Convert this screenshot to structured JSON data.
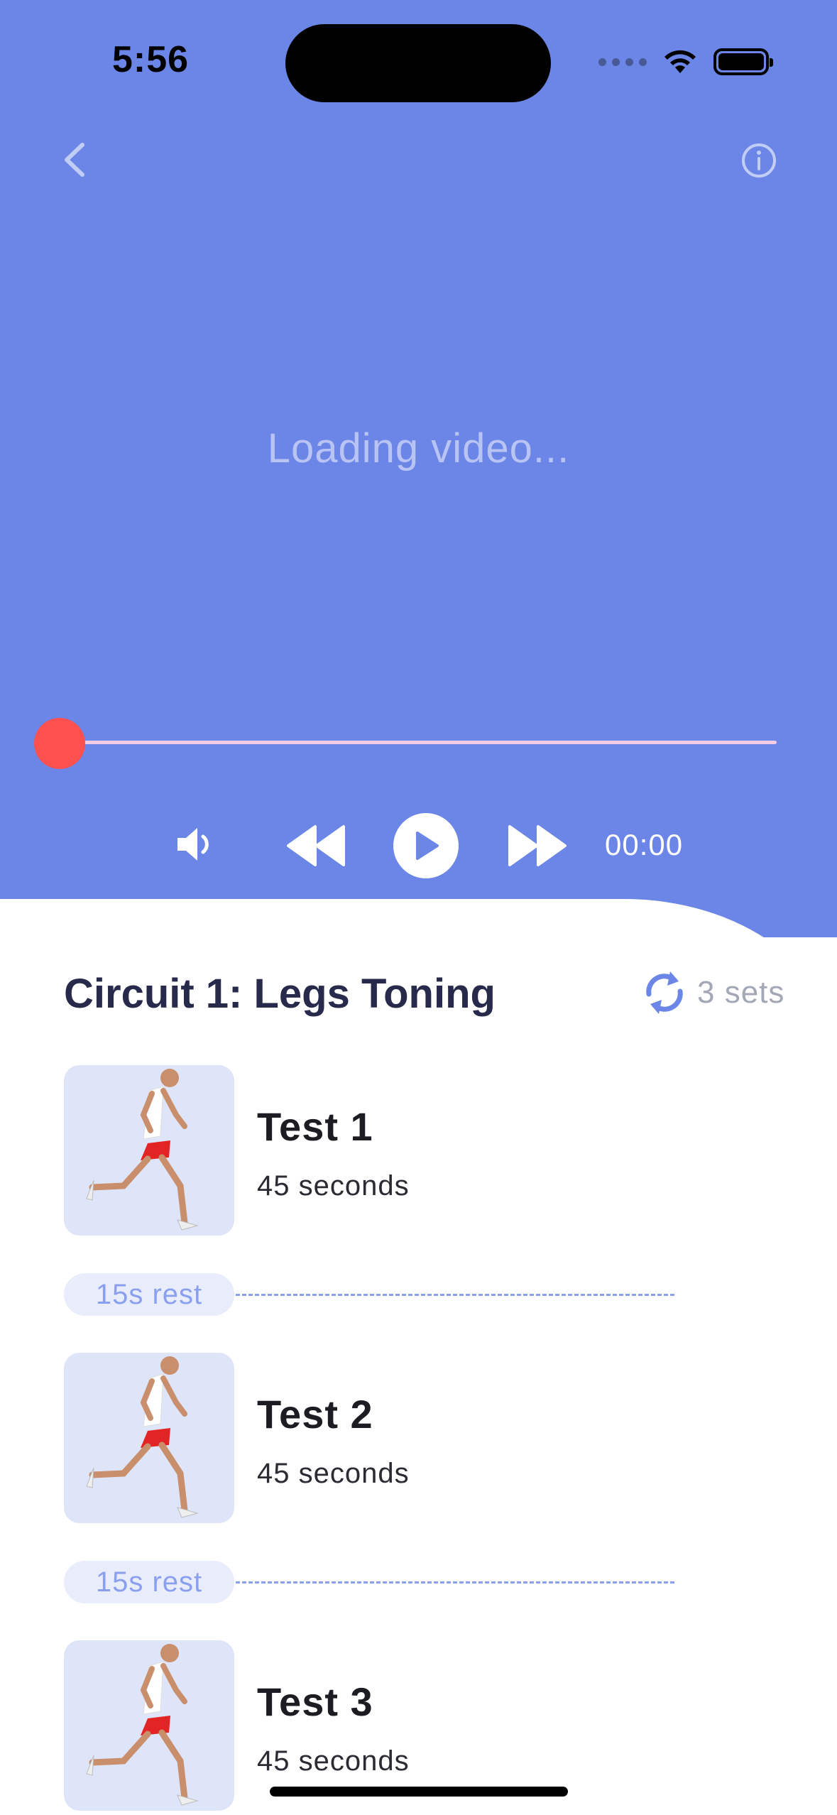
{
  "status_bar": {
    "time": "5:56"
  },
  "player": {
    "loading_text": "Loading video...",
    "progress": 0,
    "time": "00:00"
  },
  "circuit": {
    "title": "Circuit 1: Legs Toning",
    "sets": "3 sets"
  },
  "exercises": [
    {
      "name": "Test 1",
      "duration": "45 seconds"
    },
    {
      "name": "Test 2",
      "duration": "45 seconds"
    },
    {
      "name": "Test 3",
      "duration": "45 seconds"
    }
  ],
  "rests": [
    {
      "label": "15s rest"
    },
    {
      "label": "15s rest"
    }
  ],
  "icons": {
    "back": "chevron-left-icon",
    "info": "info-icon",
    "volume": "volume-icon",
    "rewind": "rewind-icon",
    "play": "play-icon",
    "forward": "fast-forward-icon",
    "repeat": "repeat-icon"
  },
  "colors": {
    "video_bg": "#6b86e6",
    "accent": "#6b86e6",
    "progress_knob": "#ff5050",
    "title": "#272a4a",
    "thumb_bg": "#dfe5f8"
  }
}
